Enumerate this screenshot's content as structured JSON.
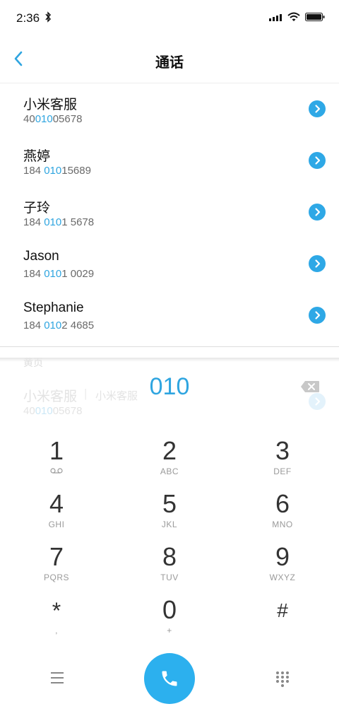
{
  "status_bar": {
    "time": "2:36"
  },
  "header": {
    "title": "通话"
  },
  "results": [
    {
      "name": "小米客服",
      "number": [
        "40",
        "010",
        "05678"
      ]
    },
    {
      "name": "燕婷",
      "number": [
        "184 ",
        "010",
        "15689"
      ]
    },
    {
      "name": "子玲",
      "number": [
        "184 ",
        "010",
        "1 5678"
      ]
    },
    {
      "name": "Jason",
      "number": [
        "184 ",
        "010",
        "1 0029"
      ]
    },
    {
      "name": "Stephanie",
      "number": [
        "184 ",
        "010",
        "2 4685"
      ]
    }
  ],
  "ghost_row": {
    "label": "黄页",
    "name": "小米客服",
    "separator": "|",
    "alias": "小米客服",
    "number": [
      "40",
      "010",
      "05678"
    ]
  },
  "dialer": {
    "input": "010",
    "keys": [
      {
        "digit": "1",
        "letters": ""
      },
      {
        "digit": "2",
        "letters": "ABC"
      },
      {
        "digit": "3",
        "letters": "DEF"
      },
      {
        "digit": "4",
        "letters": "GHI"
      },
      {
        "digit": "5",
        "letters": "JKL"
      },
      {
        "digit": "6",
        "letters": "MNO"
      },
      {
        "digit": "7",
        "letters": "PQRS"
      },
      {
        "digit": "8",
        "letters": "TUV"
      },
      {
        "digit": "9",
        "letters": "WXYZ"
      },
      {
        "digit": "*",
        "letters": ","
      },
      {
        "digit": "0",
        "letters": "+"
      },
      {
        "digit": "#",
        "letters": ""
      }
    ]
  },
  "colors": {
    "accent": "#2fa5e0",
    "call_button": "#2cb0ee"
  },
  "icons": {
    "back": "chevron-left-icon",
    "detail": "chevron-right-circle-icon",
    "delete": "backspace-icon",
    "menu": "menu-icon",
    "call": "phone-icon",
    "dialpad": "dialpad-icon",
    "voicemail": "voicemail-icon"
  }
}
